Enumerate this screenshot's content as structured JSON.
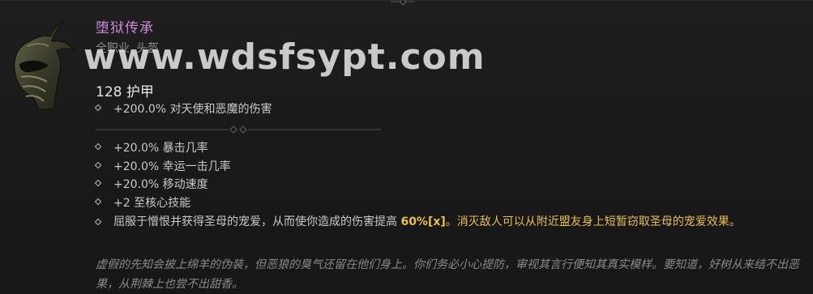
{
  "item": {
    "name": "堕狱传承",
    "class": "全职业",
    "slot": "头盔",
    "armor": "128 护甲",
    "implicit": "+200.0% 对天使和恶魔的伤害",
    "affixes": [
      "+20.0% 暴击几率",
      "+20.0% 幸运一击几率",
      "+20.0% 移动速度",
      "+2 至核心技能"
    ],
    "aspect": {
      "prefix": "屈服于憎恨并获得圣母的宠爱，从而使你造成的伤害提高 ",
      "value": "60%[x]",
      "suffix": "。消灭敌人可以从附近盟友身上短暂窃取圣母的宠爱效果。"
    },
    "flavor": "虚假的先知会披上绵羊的伪装，但恶狼的臭气还留在他们身上。你们务必小心提防，审视其言行便知其真实模样。要知道，好树从来结不出恶果，从荆棘上也尝不出甜香。"
  },
  "watermark": "www.wdsfsypt.com",
  "colors": {
    "unique_name": "#c58ad6",
    "highlight": "#e9c046",
    "flavor": "#8a8a8a"
  }
}
